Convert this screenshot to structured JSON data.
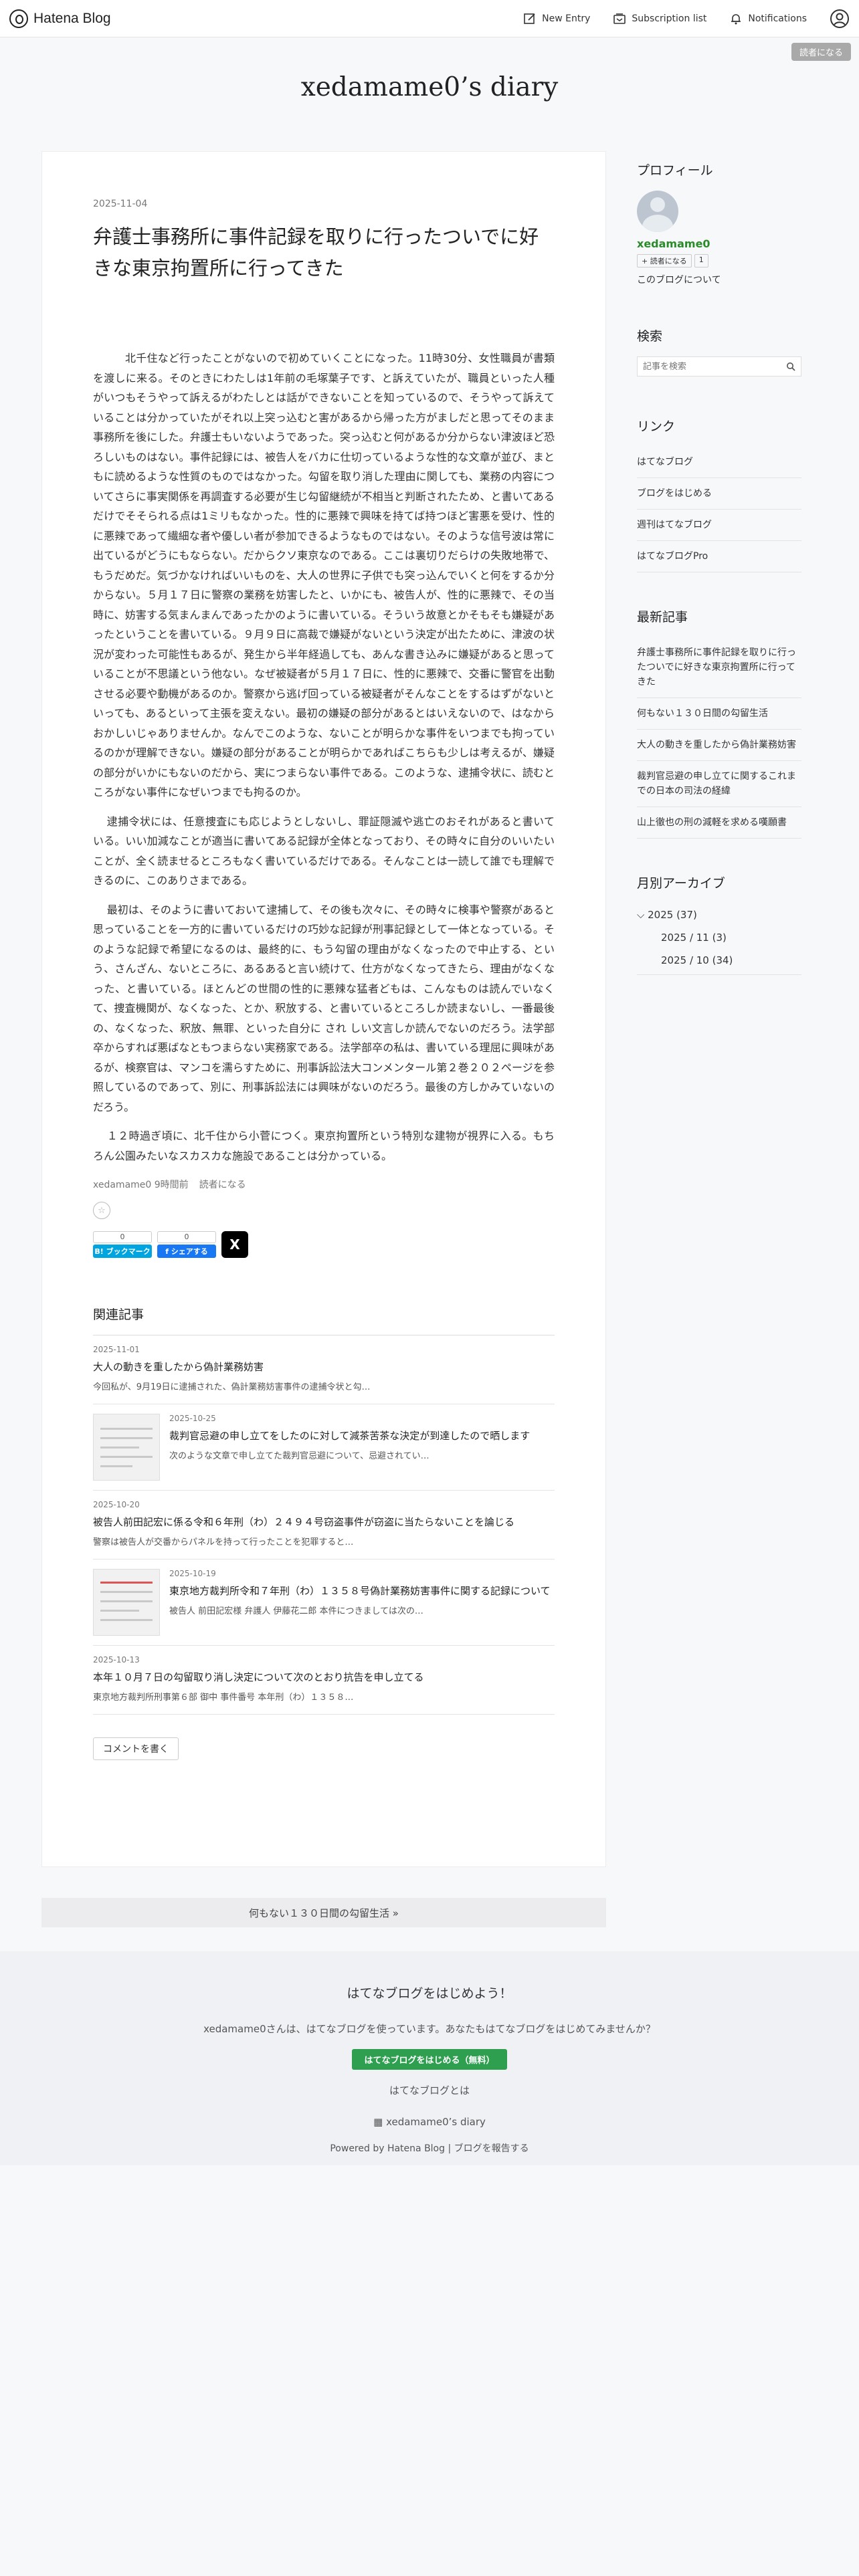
{
  "topbar": {
    "brand": "Hatena Blog",
    "new_entry": "New Entry",
    "subscription": "Subscription list",
    "notifications": "Notifications"
  },
  "reader_button": "読者になる",
  "blog_title": "xedamame0’s diary",
  "post": {
    "date": "2025-11-04",
    "title": "弁護士事務所に事件記録を取りに行ったついでに好きな東京拘置所に行ってきた",
    "paragraphs": [
      "北千住など行ったことがないので初めていくことになった。11時30分、女性職員が書類を渡しに来る。そのときにわたしは1年前の毛塚葉子です、と訴えていたが、職員といった人種がいつもそうやって訴えるがわたしとは話ができないことを知っているので、そうやって訴えていることは分かっていたがそれ以上突っ込むと害があるから帰った方がましだと思ってそのまま事務所を後にした。弁護士もいないようであった。突っ込むと何があるか分からない津波ほど恐ろしいものはない。事件記録には、被告人をバカに仕切っているような性的な文章が並び、まともに読めるような性質のものではなかった。勾留を取り消した理由に関しても、業務の内容についてさらに事実関係を再調査する必要が生じ勾留継続が不相当と判断されたため、と書いてあるだけでそそられる点は1ミリもなかった。性的に悪辣で興味を持てば持つほど害悪を受け、性的に悪辣であって繊細な者や優しい者が参加できるようなものではない。そのような信号波は常に出ているがどうにもならない。だからクソ東京なのである。ここは裏切りだらけの失敗地帯で、もうだめだ。気づかなければいいものを、大人の世界に子供でも突っ込んでいくと何をするか分からない。５月１７日に警察の業務を妨害したと、いかにも、被告人が、性的に悪辣で、その当時に、妨害する気まんまんであったかのように書いている。そういう故意とかそもそも嫌疑があったということを書いている。９月９日に高裁で嫌疑がないという決定が出たために、津波の状況が変わった可能性もあるが、発生から半年経過しても、あんな書き込みに嫌疑があると思っていることが不思議という他ない。なぜ被疑者が５月１７日に、性的に悪辣で、交番に警官を出動させる必要や動機があるのか。警察から逃げ回っている被疑者がそんなことをするはずがないといっても、あるといって主張を変えない。最初の嫌疑の部分があるとはいえないので、はなからおかしいじゃありませんか。なんでこのような、ないことが明らかな事件をいつまでも拘っているのかが理解できない。嫌疑の部分があることが明らかであればこちらも少しは考えるが、嫌疑の部分がいかにもないのだから、実につまらない事件である。このような、逮捕令状に、読むところがない事件になぜいつまでも拘るのか。",
      "逮捕令状には、任意捜査にも応じようとしないし、罪証隠滅や逃亡のおそれがあると書いている。いい加減なことが適当に書いてある記録が全体となっており、その時々に自分のいいたいことが、全く読ませるところもなく書いているだけである。そんなことは一読して誰でも理解できるのに、このありさまである。",
      "最初は、そのように書いておいて逮捕して、その後も次々に、その時々に検事や警察があると思っていることを一方的に書いているだけの巧妙な記録が刑事記録として一体となっている。そのような記録で希望になるのは、最終的に、もう勾留の理由がなくなったので中止する、という、さんざん、ないところに、あるあると言い続けて、仕方がなくなってきたら、理由がなくなった、と書いている。ほとんどの世間の性的に悪辣な猛者どもは、こんなものは読んでいなくて、捜査機関が、なくなった、とか、釈放する、と書いているところしか読まないし、一番最後の、なくなった、釈放、無罪、といった自分に され しい文言しか読んでないのだろう。法学部卒からすれば悪ばなともつまらない実務家である。法学部卒の私は、書いている理屈に興味があるが、検察官は、マンコを濡らすために、刑事訴訟法大コンメンタール第２巻２０２ページを参照しているのであって、別に、刑事訴訟法には興味がないのだろう。最後の方しかみていないのだろう。",
      "１２時過ぎ頃に、北千住から小菅につく。東京拘置所という特別な建物が視界に入る。もちろん公園みたいなスカスカな施設であることは分かっている。"
    ],
    "meta_author": "xedamame0",
    "meta_time": "9時間前",
    "meta_reader": "読者になる",
    "star": "☆",
    "share": {
      "bookmark_count": "0",
      "bookmark_label": "B! ブックマーク",
      "facebook_count": "0",
      "facebook_label": "f シェアする",
      "x_label": "X"
    },
    "bookmark_color": "#00a4de",
    "facebook_color": "#1877f2"
  },
  "related": {
    "title": "関連記事",
    "items": [
      {
        "date": "2025-11-01",
        "title": "大人の動きを重したから偽計業務妨害",
        "snippet": "今回私が、9月19日に逮捕された、偽計業務妨害事件の逮捕令状と勾…"
      },
      {
        "date": "2025-10-25",
        "title": "裁判官忌避の申し立てをしたのに対して減茶苦茶な決定が到達したので晒します",
        "snippet": "次のような文章で申し立てた裁判官忌避について、忌避されてい…"
      },
      {
        "date": "2025-10-20",
        "title": "被告人前田記宏に係る令和６年刑（わ）２４９４号窃盗事件が窃盗に当たらないことを論じる",
        "snippet": "警察は被告人が交番からパネルを持って行ったことを犯罪すると…"
      },
      {
        "date": "2025-10-19",
        "title": "東京地方裁判所令和７年刑（わ）１３５８号偽計業務妨害事件に関する記録について",
        "snippet": "被告人 前田記宏様 弁護人 伊藤花二郎 本件につきましては次の…"
      },
      {
        "date": "2025-10-13",
        "title": "本年１０月７日の勾留取り消し決定について次のとおり抗告を申し立てる",
        "snippet": "東京地方裁判所刑事第６部 御中 事件番号 本年刑（わ）１３５８…"
      }
    ],
    "comment_button": "コメントを書く"
  },
  "sidebar": {
    "profile_title": "プロフィール",
    "username": "xedamame0",
    "reader_badge": "+ 読者になる",
    "reader_count": "1",
    "about": "このブログについて",
    "search_title": "検索",
    "search_placeholder": "記事を検索",
    "links_title": "リンク",
    "links": [
      "はてなブログ",
      "ブログをはじめる",
      "週刊はてなブログ",
      "はてなブログPro"
    ],
    "recent_title": "最新記事",
    "recent": [
      "弁護士事務所に事件記録を取りに行ったついでに好きな東京拘置所に行ってきた",
      "何もない１３０日間の勾留生活",
      "大人の動きを重したから偽計業務妨害",
      "裁判官忌避の申し立てに関するこれまでの日本の司法の経緯",
      "山上徹也の刑の減軽を求める嘆願書"
    ],
    "archive_title": "月別アーカイブ",
    "archive_year": "2025 (37)",
    "archive_months": [
      "2025 / 11 (3)",
      "2025 / 10 (34)"
    ]
  },
  "pager": "何もない１３０日間の勾留生活 »",
  "footer": {
    "title": "はてなブログをはじめよう！",
    "message": "xedamame0さんは、はてなブログを使っています。あなたもはてなブログをはじめてみませんか？",
    "start_button": "はてなブログをはじめる（無料）",
    "about": "はてなブログとは",
    "diary": "xedamame0’s diary",
    "powered": "Powered by Hatena Blog | ブログを報告する"
  }
}
